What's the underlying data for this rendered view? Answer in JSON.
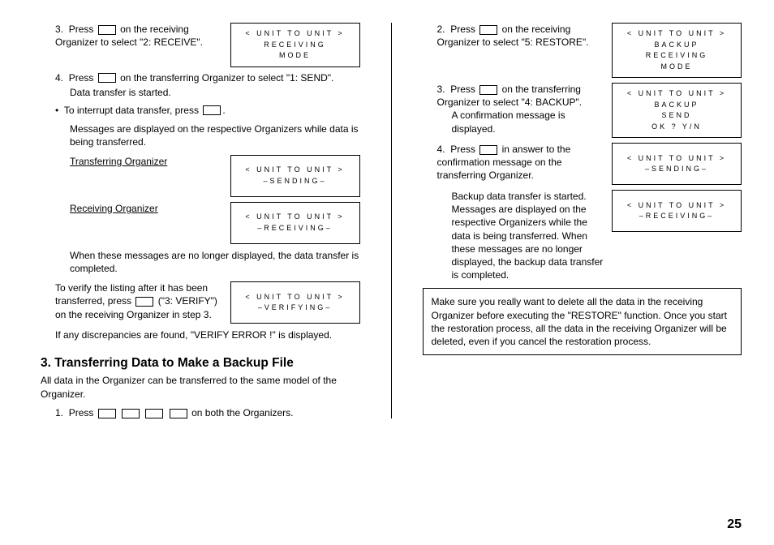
{
  "left": {
    "step3_a": "Press",
    "step3_b": "on the receiving Organizer to select \"2: RECEIVE\".",
    "box1_line1": "< UNIT TO UNIT >",
    "box1_line2": "RECEIVING",
    "box1_line3": "MODE",
    "step4_a": "Press",
    "step4_b": "on the transferring Organizer to select \"1: SEND\".",
    "dataStart": "Data transfer is started.",
    "interrupt_a": "To interrupt data transfer, press",
    "interrupt_b": ".",
    "messages": "Messages are displayed on the respective Organizers while data is being transferred.",
    "transOrg": "Transferring Organizer",
    "box2_line1": "< UNIT TO UNIT >",
    "box2_line2": "–SENDING–",
    "recvOrg": "Receiving Organizer",
    "box3_line1": "< UNIT TO UNIT >",
    "box3_line2": "–RECEIVING–",
    "whenMsg": "When these messages are no longer displayed, the data transfer is completed.",
    "verify_a": "To verify the listing after it has been transferred, press",
    "verify_b": "(\"3: VERIFY\") on the receiving Organizer in step 3.",
    "box4_line1": "< UNIT TO UNIT >",
    "box4_line2": "–VERIFYING–",
    "discrep": "If any discrepancies are found, \"VERIFY ERROR !\" is displayed.",
    "sectionTitle": "3. Transferring Data to Make a Backup File",
    "sectionIntro": "All data in the Organizer can be transferred to the same model of the Organizer.",
    "bstep1_a": "Press",
    "bstep1_b": "on both the Organizers."
  },
  "right": {
    "step2_a": "Press",
    "step2_b": "on the receiving Organizer to select \"5: RESTORE\".",
    "box1_l1": "< UNIT TO UNIT >",
    "box1_l2": "BACKUP",
    "box1_l3": "RECEIVING",
    "box1_l4": "MODE",
    "step3_a": "Press",
    "step3_b": "on the transferring Organizer to select \"4: BACKUP\".",
    "step3_c": "A confirmation message is displayed.",
    "box2_l1": "< UNIT TO UNIT >",
    "box2_l2": "BACKUP",
    "box2_l3": "SEND",
    "box2_l4": "OK ? Y/N",
    "step4_a": "Press",
    "step4_b": "in answer to the confirmation message on the transferring Organizer.",
    "box3_l1": "< UNIT TO UNIT >",
    "box3_l2": "–SENDING–",
    "backupStart": "Backup data transfer is started. Messages are displayed on the respective Organizers while the data is being transferred. When these messages are no longer displayed, the backup data transfer is completed.",
    "box4_l1": "< UNIT TO UNIT >",
    "box4_l2": "–RECEIVING–",
    "note": "Make sure you really want to delete all the data in the receiving Organizer before executing the \"RESTORE\" function. Once you start the restoration process, all the data in the receiving Organizer will be deleted, even if you cancel the restoration process."
  },
  "pageNum": "25"
}
